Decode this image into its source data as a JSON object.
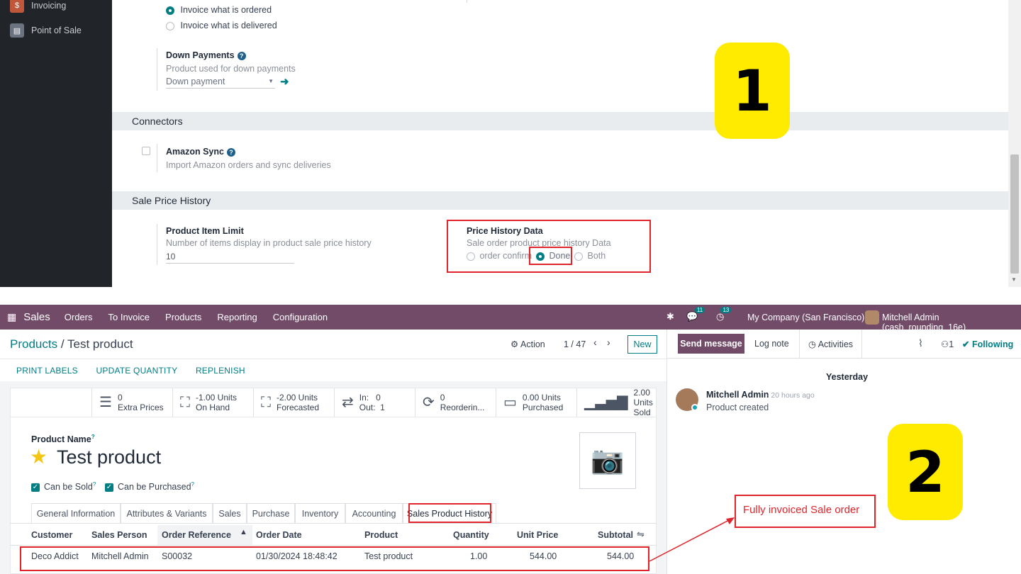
{
  "sidebar": {
    "items": [
      {
        "label": "Invoicing",
        "icon": "invoicing-icon",
        "color": "#c0563a"
      },
      {
        "label": "Point of Sale",
        "icon": "point-of-sale-icon",
        "color": "#6b7280"
      }
    ]
  },
  "settings": {
    "invoicing_policy": {
      "option_ordered": "Invoice what is ordered",
      "option_delivered": "Invoice what is delivered"
    },
    "down_payments": {
      "title": "Down Payments",
      "desc": "Product used for down payments",
      "value": "Down payment"
    },
    "connectors": {
      "section": "Connectors",
      "amazon_title": "Amazon Sync",
      "amazon_desc": "Import Amazon orders and sync deliveries"
    },
    "sale_price_history": {
      "section": "Sale Price History",
      "limit_title": "Product Item Limit",
      "limit_desc": "Number of items display in product sale price history",
      "limit_value": "10",
      "data_title": "Price History Data",
      "data_desc": "Sale order product price history Data",
      "opt_confirm": "order confirm",
      "opt_done": "Done",
      "opt_both": "Both"
    },
    "callout_1": "1"
  },
  "navbar": {
    "app": "Sales",
    "menu": [
      "Orders",
      "To Invoice",
      "Products",
      "Reporting",
      "Configuration"
    ],
    "messages_count": "11",
    "activities_count": "13",
    "company": "My Company (San Francisco)",
    "user": "Mitchell Admin (cash_rounding_16e)"
  },
  "form": {
    "breadcrumb_parent": "Products",
    "breadcrumb_sep": "/",
    "breadcrumb_current": "Test product",
    "action_label": "Action",
    "pager": "1 / 47",
    "new_label": "New",
    "buttons": [
      "PRINT LABELS",
      "UPDATE QUANTITY",
      "REPLENISH"
    ],
    "stats": [
      {
        "icon": "list-icon",
        "value": "0",
        "label": "Extra Prices"
      },
      {
        "icon": "cubes-icon",
        "value": "-1.00 Units",
        "label": "On Hand"
      },
      {
        "icon": "cubes-icon",
        "value": "-2.00 Units",
        "label": "Forecasted"
      },
      {
        "icon": "exchange-icon",
        "value": "In:   0",
        "label": "Out:  1"
      },
      {
        "icon": "refresh-icon",
        "value": "0",
        "label": "Reorderin..."
      },
      {
        "icon": "credit-card-icon",
        "value": "0.00 Units",
        "label": "Purchased"
      },
      {
        "icon": "signal-icon",
        "value": "2.00 Units",
        "label": "Sold"
      }
    ],
    "product_name_label": "Product Name",
    "product_name": "Test product",
    "can_be_sold": "Can be Sold",
    "can_be_purchased": "Can be Purchased",
    "tabs": [
      "General Information",
      "Attributes & Variants",
      "Sales",
      "Purchase",
      "Inventory",
      "Accounting",
      "Sales Product History"
    ],
    "table": {
      "headers": [
        "Customer",
        "Sales Person",
        "Order Reference",
        "Order Date",
        "Product",
        "Quantity",
        "Unit Price",
        "Subtotal"
      ],
      "rows": [
        [
          "Deco Addict",
          "Mitchell Admin",
          "S00032",
          "01/30/2024 18:48:42",
          "Test product",
          "1.00",
          "544.00",
          "544.00"
        ]
      ]
    }
  },
  "chatter": {
    "send_message": "Send message",
    "log_note": "Log note",
    "activities": "Activities",
    "followers_count": "1",
    "following": "Following",
    "date_separator": "Yesterday",
    "author": "Mitchell Admin",
    "time": "- 20 hours ago",
    "message": "Product created"
  },
  "annotation": {
    "callout_2": "2",
    "note": "Fully invoiced Sale order"
  },
  "colors": {
    "brand": "#714b67",
    "accent": "#017e84",
    "highlight": "#ffeb00",
    "annotation_red": "#e0242b"
  }
}
